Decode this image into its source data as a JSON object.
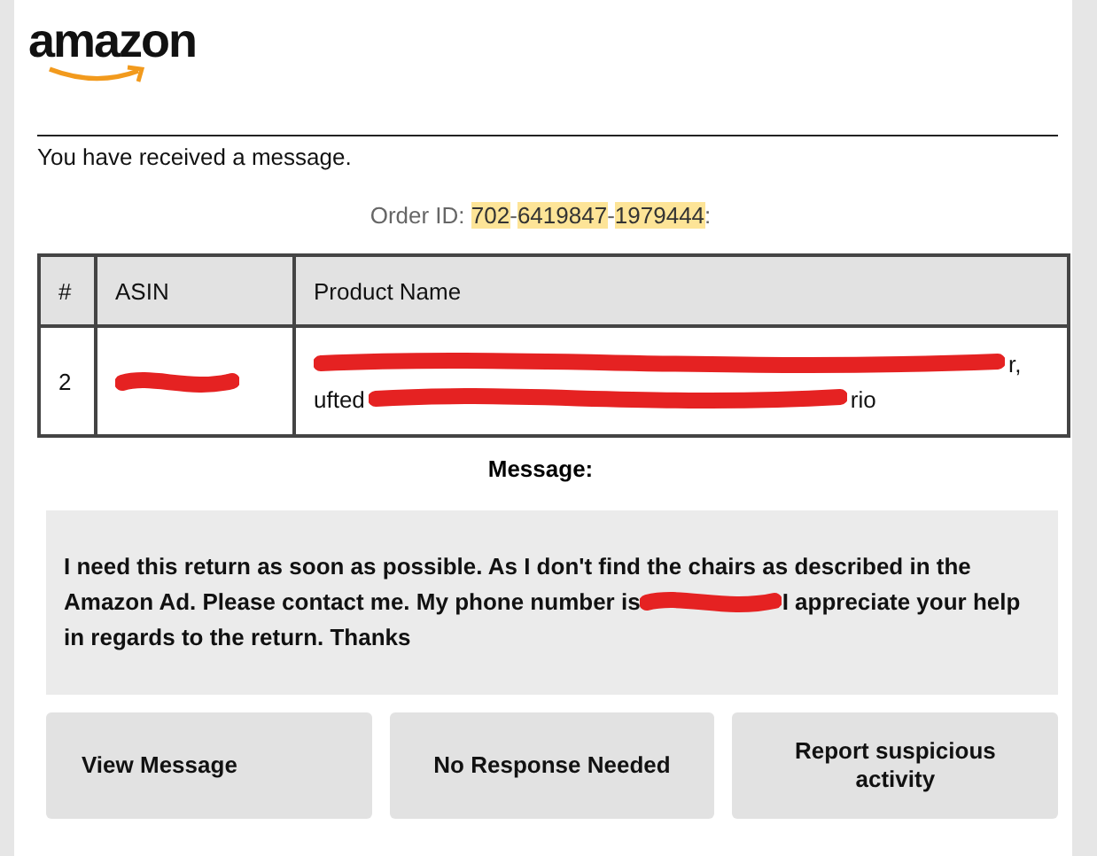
{
  "logo": {
    "text": "amazon"
  },
  "intro": "You have received a message.",
  "order": {
    "label": "Order ID: ",
    "segments": [
      {
        "text": "702",
        "highlighted": true
      },
      {
        "text": "-",
        "highlighted": false
      },
      {
        "text": "6419847",
        "highlighted": true
      },
      {
        "text": "-",
        "highlighted": false
      },
      {
        "text": "1979444",
        "highlighted": true
      },
      {
        "text": ":",
        "highlighted": false
      }
    ]
  },
  "table": {
    "columns": [
      "#",
      "ASIN",
      "Product Name"
    ],
    "rows": [
      {
        "number": "2",
        "asin": [
          {
            "kind": "redaction"
          }
        ],
        "product_lines": [
          [
            {
              "kind": "redaction"
            },
            {
              "kind": "text",
              "text": "r,"
            }
          ],
          [
            {
              "kind": "text",
              "text": "ufted"
            },
            {
              "kind": "redaction"
            },
            {
              "kind": "text",
              "text": "rio"
            }
          ]
        ]
      }
    ]
  },
  "message": {
    "heading": "Message:",
    "lines": [
      [
        {
          "kind": "text",
          "text": "I need this return as soon as possible. As I don't find the chairs as described in the"
        }
      ],
      [
        {
          "kind": "text",
          "text": "Amazon Ad. Please contact me. My phone number is"
        },
        {
          "kind": "redaction"
        },
        {
          "kind": "text",
          "text": "I appreciate your help"
        }
      ],
      [
        {
          "kind": "text",
          "text": "in regards to the return. Thanks"
        }
      ]
    ]
  },
  "buttons": [
    "View Message",
    "No Response Needed",
    "Report suspicious activity"
  ]
}
